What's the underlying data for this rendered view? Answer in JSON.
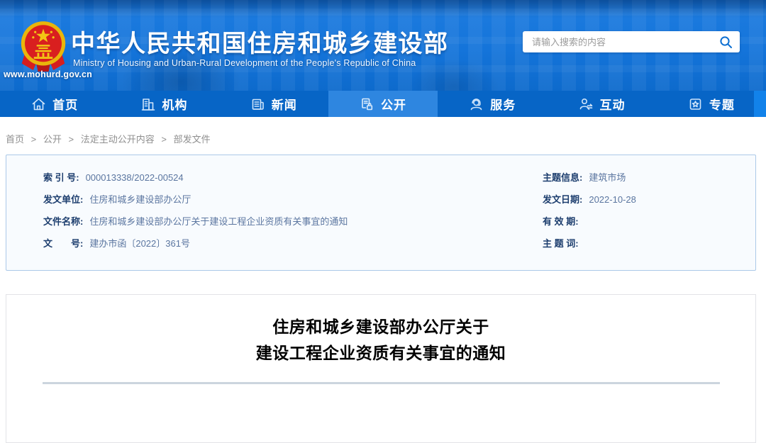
{
  "header": {
    "site_url": "www.mohurd.gov.cn",
    "title_cn": "中华人民共和国住房和城乡建设部",
    "title_en": "Ministry of Housing and Urban-Rural Development of the People's Republic of China",
    "search": {
      "placeholder": "请输入搜索的内容"
    }
  },
  "nav": {
    "items": [
      {
        "label": "首页",
        "icon": "home-icon",
        "active": false
      },
      {
        "label": "机构",
        "icon": "building-icon",
        "active": false
      },
      {
        "label": "新闻",
        "icon": "news-icon",
        "active": false
      },
      {
        "label": "公开",
        "icon": "disclosure-icon",
        "active": true
      },
      {
        "label": "服务",
        "icon": "service-icon",
        "active": false
      },
      {
        "label": "互动",
        "icon": "interaction-icon",
        "active": false
      },
      {
        "label": "专题",
        "icon": "topic-icon",
        "active": false
      }
    ]
  },
  "breadcrumb": {
    "separator": ">",
    "items": [
      "首页",
      "公开",
      "法定主动公开内容",
      "部发文件"
    ]
  },
  "meta": {
    "left": [
      {
        "label": "索 引 号:",
        "value": "000013338/2022-00524"
      },
      {
        "label": "发文单位:",
        "value": "住房和城乡建设部办公厅"
      },
      {
        "label": "文件名称:",
        "value": "住房和城乡建设部办公厅关于建设工程企业资质有关事宜的通知"
      },
      {
        "label": "文　　号:",
        "value": "建办市函〔2022〕361号"
      }
    ],
    "right": [
      {
        "label": "主题信息:",
        "value": "建筑市场"
      },
      {
        "label": "发文日期:",
        "value": "2022-10-28"
      },
      {
        "label": "有 效 期:",
        "value": ""
      },
      {
        "label": "主 题 词:",
        "value": ""
      }
    ]
  },
  "document": {
    "title_line1": "住房和城乡建设部办公厅关于",
    "title_line2": "建设工程企业资质有关事宜的通知"
  },
  "colors": {
    "nav_blue": "#0765c6",
    "nav_active_blue": "#2e86e0",
    "header_blue": "#1474da",
    "meta_border": "#abc9e8",
    "meta_label": "#1d3e6e",
    "meta_value": "#5b76a0",
    "search_icon_blue": "#0b6ed1"
  }
}
